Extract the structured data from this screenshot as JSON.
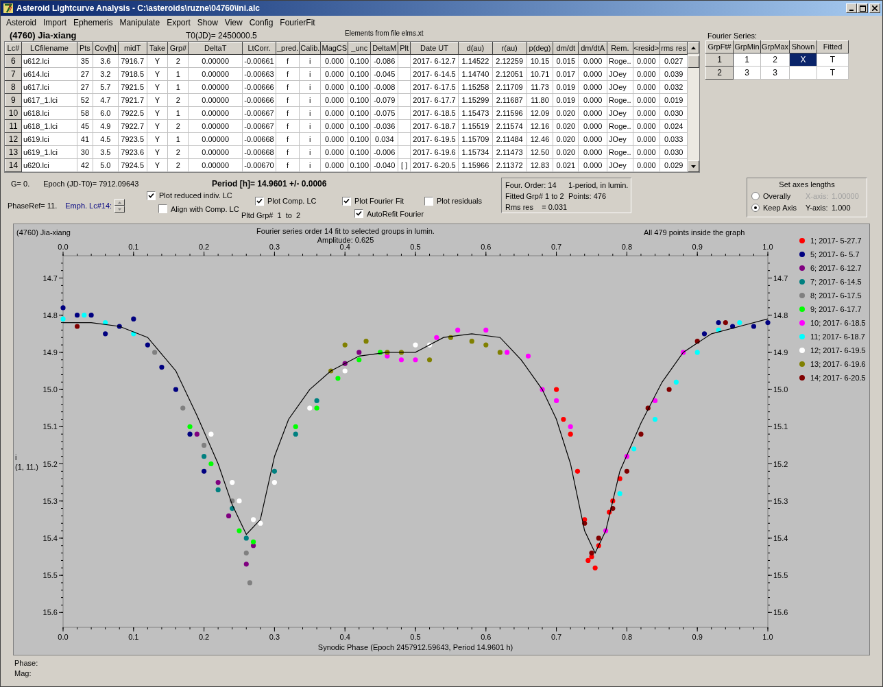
{
  "window": {
    "title": "Asteroid Lightcurve Analysis - C:\\asteroids\\ruzne\\04760\\ini.alc"
  },
  "menu": [
    "Asteroid",
    "Import",
    "Ephemeris",
    "Manipulate",
    "Export",
    "Show",
    "View",
    "Config",
    "FourierFit"
  ],
  "header": {
    "asteroid": "(4760) Jia-xiang",
    "t0": "T0(JD)= 2450000.5",
    "elements": "Elements from file elms.xt"
  },
  "table": {
    "columns": [
      "Lc#",
      "LCfilename",
      "Pts",
      "Cov[h]",
      "midT",
      "Take",
      "Grp#",
      "DeltaT",
      "LtCorr.",
      "_pred.",
      "Calib.",
      "MagCS",
      "_unc",
      "DeltaM",
      "Plt",
      "Date UT",
      "d(au)",
      "r(au)",
      "p(deg)",
      "dm/dt",
      "dm/dtA",
      "Rem.",
      "<resid>",
      "rms res"
    ],
    "rows": [
      {
        "cells": [
          "6",
          "u612.lci",
          "35",
          "3.6",
          "7916.7",
          "Y",
          "2",
          "0.00000",
          "-0.00661",
          "f",
          "i",
          "0.000",
          "0.100",
          "-0.086",
          null,
          "2017- 6-12.7",
          "1.14522",
          "2.12259",
          "10.15",
          "0.015",
          "0.000",
          "Roge..",
          "0.000",
          "0.027"
        ]
      },
      {
        "cells": [
          "7",
          "u614.lci",
          "27",
          "3.2",
          "7918.5",
          "Y",
          "1",
          "0.00000",
          "-0.00663",
          "f",
          "i",
          "0.000",
          "0.100",
          "-0.045",
          null,
          "2017- 6-14.5",
          "1.14740",
          "2.12051",
          "10.71",
          "0.017",
          "0.000",
          "JOey",
          "0.000",
          "0.039"
        ]
      },
      {
        "cells": [
          "8",
          "u617.lci",
          "27",
          "5.7",
          "7921.5",
          "Y",
          "1",
          "0.00000",
          "-0.00666",
          "f",
          "i",
          "0.000",
          "0.100",
          "-0.008",
          null,
          "2017- 6-17.5",
          "1.15258",
          "2.11709",
          "11.73",
          "0.019",
          "0.000",
          "JOey",
          "0.000",
          "0.032"
        ]
      },
      {
        "cells": [
          "9",
          "u617_1.lci",
          "52",
          "4.7",
          "7921.7",
          "Y",
          "2",
          "0.00000",
          "-0.00666",
          "f",
          "i",
          "0.000",
          "0.100",
          "-0.079",
          null,
          "2017- 6-17.7",
          "1.15299",
          "2.11687",
          "11.80",
          "0.019",
          "0.000",
          "Roge..",
          "0.000",
          "0.019"
        ]
      },
      {
        "cells": [
          "10",
          "u618.lci",
          "58",
          "6.0",
          "7922.5",
          "Y",
          "1",
          "0.00000",
          "-0.00667",
          "f",
          "i",
          "0.000",
          "0.100",
          "-0.075",
          null,
          "2017- 6-18.5",
          "1.15473",
          "2.11596",
          "12.09",
          "0.020",
          "0.000",
          "JOey",
          "0.000",
          "0.030"
        ]
      },
      {
        "cells": [
          "11",
          "u618_1.lci",
          "45",
          "4.9",
          "7922.7",
          "Y",
          "2",
          "0.00000",
          "-0.00667",
          "f",
          "i",
          "0.000",
          "0.100",
          "-0.036",
          null,
          "2017- 6-18.7",
          "1.15519",
          "2.11574",
          "12.16",
          "0.020",
          "0.000",
          "Roge..",
          "0.000",
          "0.024"
        ]
      },
      {
        "cells": [
          "12",
          "u619.lci",
          "41",
          "4.5",
          "7923.5",
          "Y",
          "1",
          "0.00000",
          "-0.00668",
          "f",
          "i",
          "0.000",
          "0.100",
          "0.034",
          null,
          "2017- 6-19.5",
          "1.15709",
          "2.11484",
          "12.46",
          "0.020",
          "0.000",
          "JOey",
          "0.000",
          "0.033"
        ]
      },
      {
        "cells": [
          "13",
          "u619_1.lci",
          "30",
          "3.5",
          "7923.6",
          "Y",
          "2",
          "0.00000",
          "-0.00668",
          "f",
          "i",
          "0.000",
          "0.100",
          "-0.006",
          null,
          "2017- 6-19.6",
          "1.15734",
          "2.11473",
          "12.50",
          "0.020",
          "0.000",
          "Roge..",
          "0.000",
          "0.030"
        ]
      },
      {
        "cells": [
          "14",
          "u620.lci",
          "42",
          "5.0",
          "7924.5",
          "Y",
          "2",
          "0.00000",
          "-0.00670",
          "f",
          "i",
          "0.000",
          "0.100",
          "-0.040",
          "[ ]",
          "2017- 6-20.5",
          "1.15966",
          "2.11372",
          "12.83",
          "0.021",
          "0.000",
          "JOey",
          "0.000",
          "0.029"
        ]
      }
    ]
  },
  "fourier": {
    "title": "Fourier Series:",
    "columns": [
      "GrpFt#",
      "GrpMin",
      "GrpMax",
      "Shown",
      "Fitted"
    ],
    "rows": [
      {
        "cells": [
          "1",
          "1",
          "2",
          "X",
          "T"
        ],
        "selected": true
      },
      {
        "cells": [
          "2",
          "3",
          "3",
          null,
          "T"
        ],
        "selected": false
      }
    ]
  },
  "controls": {
    "g": "G= 0.",
    "epoch": "Epoch (JD-T0)= 7912.09643",
    "period": "Period [h]= 14.9601 +/- 0.0006",
    "phase_ref": "PhaseRef= 11.",
    "emph": "Emph. Lc#14:",
    "pltd_grp": "Pltd Grp#  1  to  2",
    "checkboxes": [
      {
        "label": "Plot reduced indiv. LC",
        "checked": true
      },
      {
        "label": "Align with Comp. LC",
        "checked": false
      },
      {
        "label": "Plot Comp. LC",
        "checked": true
      },
      {
        "label": "Plot Fourier Fit",
        "checked": true
      },
      {
        "label": "Plot residuals",
        "checked": false
      },
      {
        "label": "AutoRefit Fourier",
        "checked": true
      }
    ]
  },
  "fit_info": [
    "Four. Order: 14",
    "1-period, in lumin.",
    "Fitted Grp# 1 to 2",
    "Points: 476",
    "Rms res    = 0.031"
  ],
  "axes": {
    "title": "Set axes lengths",
    "radios": [
      {
        "label": "Overally",
        "selected": false
      },
      {
        "label": "Keep Axis",
        "selected": true
      }
    ],
    "fields": [
      {
        "label": "X-axis:",
        "value": "1.00000",
        "disabled": true
      },
      {
        "label": "Y-axis:",
        "value": "1.000",
        "disabled": false
      }
    ]
  },
  "plot": {
    "object": "(4760) Jia-xiang",
    "subtitle": "Fourier series order 14 fit to selected groups in lumin.",
    "amplitude": "Amplitude: 0.625",
    "points_note": "All 479 points inside the graph",
    "y_units": "(1, 11.)",
    "right_axis_labels": [
      "14.7",
      "14.8",
      "14.9",
      "15.0",
      "15.1",
      "15.2",
      "15.3",
      "15.4",
      "15.5",
      "15.6"
    ],
    "chart_data": {
      "type": "scatter",
      "xlabel": "Synodic Phase (Epoch 2457912.59643, Period 14.9601 h)",
      "ylabel": "i",
      "xlim": [
        0,
        1
      ],
      "ylim": [
        15.64,
        14.64
      ],
      "xticks": [
        {
          "value": 0,
          "label": "0.0"
        },
        {
          "value": 0.1,
          "label": "0.1"
        },
        {
          "value": 0.2,
          "label": "0.2"
        },
        {
          "value": 0.3,
          "label": "0.3"
        },
        {
          "value": 0.4,
          "label": "0.4"
        },
        {
          "value": 0.5,
          "label": "0.5"
        },
        {
          "value": 0.6,
          "label": "0.6"
        },
        {
          "value": 0.7,
          "label": "0.7"
        },
        {
          "value": 0.8,
          "label": "0.8"
        },
        {
          "value": 0.9,
          "label": "0.9"
        },
        {
          "value": 1,
          "label": "1.0"
        }
      ],
      "yticks": [
        14.7,
        14.8,
        14.9,
        {
          "value": 15,
          "label": "15.0"
        },
        15.1,
        15.2,
        15.3,
        15.4,
        15.5,
        15.6
      ],
      "series": [
        {
          "name": "1; 2017- 5-27.7",
          "color": "#ff0000",
          "x": [
            0.7,
            0.71,
            0.72,
            0.73,
            0.74,
            0.745,
            0.75,
            0.755,
            0.76,
            0.775,
            0.78,
            0.79
          ],
          "values": [
            15.0,
            15.08,
            15.12,
            15.22,
            15.35,
            15.46,
            15.45,
            15.48,
            15.42,
            15.33,
            15.3,
            15.24
          ]
        },
        {
          "name": "5; 2017- 6- 5.7",
          "color": "#000080",
          "x": [
            0,
            0.02,
            0.04,
            0.06,
            0.08,
            0.1,
            0.12,
            0.14,
            0.16,
            0.18,
            0.2,
            0.91,
            0.93,
            0.95,
            0.98,
            1
          ],
          "values": [
            14.78,
            14.8,
            14.8,
            14.85,
            14.83,
            14.81,
            14.88,
            14.94,
            15.0,
            15.12,
            15.22,
            14.85,
            14.82,
            14.83,
            14.83,
            14.82
          ]
        },
        {
          "name": "6; 2017- 6-12.7",
          "color": "#800080",
          "x": [
            0.19,
            0.22,
            0.235,
            0.26,
            0.27,
            0.4,
            0.42
          ],
          "values": [
            15.12,
            15.25,
            15.34,
            15.47,
            15.42,
            14.93,
            14.9
          ]
        },
        {
          "name": "7; 2017- 6-14.5",
          "color": "#008080",
          "x": [
            0.2,
            0.22,
            0.24,
            0.26,
            0.3,
            0.33,
            0.36
          ],
          "values": [
            15.18,
            15.27,
            15.32,
            15.4,
            15.22,
            15.12,
            15.03
          ]
        },
        {
          "name": "8; 2017- 6-17.5",
          "color": "#808080",
          "x": [
            0.13,
            0.17,
            0.2,
            0.24,
            0.26,
            0.265
          ],
          "values": [
            14.9,
            15.05,
            15.15,
            15.3,
            15.44,
            15.52
          ]
        },
        {
          "name": "9; 2017- 6-17.7",
          "color": "#00ff00",
          "x": [
            0.18,
            0.21,
            0.25,
            0.27,
            0.33,
            0.36,
            0.39,
            0.42,
            0.45
          ],
          "values": [
            15.1,
            15.2,
            15.38,
            15.41,
            15.1,
            15.05,
            14.97,
            14.92,
            14.9
          ]
        },
        {
          "name": "10; 2017- 6-18.5",
          "color": "#ff00ff",
          "x": [
            0.46,
            0.48,
            0.5,
            0.53,
            0.56,
            0.6,
            0.63,
            0.66,
            0.68,
            0.7,
            0.72,
            0.77,
            0.8,
            0.84,
            0.88
          ],
          "values": [
            14.91,
            14.92,
            14.92,
            14.86,
            14.84,
            14.84,
            14.9,
            14.91,
            15.0,
            15.03,
            15.1,
            15.38,
            15.18,
            15.03,
            14.9
          ]
        },
        {
          "name": "11; 2017- 6-18.7",
          "color": "#00ffff",
          "x": [
            0,
            0.03,
            0.06,
            0.1,
            0.79,
            0.81,
            0.84,
            0.87,
            0.9,
            0.93,
            0.96
          ],
          "values": [
            14.81,
            14.8,
            14.82,
            14.85,
            15.28,
            15.16,
            15.08,
            14.98,
            14.9,
            14.84,
            14.82
          ]
        },
        {
          "name": "12; 2017- 6-19.5",
          "color": "#ffffff",
          "x": [
            0.21,
            0.24,
            0.25,
            0.27,
            0.28,
            0.3,
            0.35,
            0.4,
            0.5,
            0.52
          ],
          "values": [
            15.12,
            15.25,
            15.3,
            15.35,
            15.36,
            15.25,
            15.05,
            14.95,
            14.88,
            14.88
          ]
        },
        {
          "name": "13; 2017- 6-19.6",
          "color": "#808000",
          "x": [
            0.38,
            0.4,
            0.43,
            0.46,
            0.48,
            0.52,
            0.55,
            0.58,
            0.6,
            0.62
          ],
          "values": [
            14.95,
            14.88,
            14.87,
            14.9,
            14.9,
            14.92,
            14.86,
            14.87,
            14.88,
            14.9
          ]
        },
        {
          "name": "14; 2017- 6-20.5",
          "color": "#800000",
          "x": [
            0.02,
            0.74,
            0.75,
            0.76,
            0.78,
            0.8,
            0.82,
            0.83,
            0.86,
            0.9,
            0.94
          ],
          "values": [
            14.83,
            15.36,
            15.44,
            15.4,
            15.32,
            15.22,
            15.12,
            15.05,
            15.0,
            14.87,
            14.82
          ]
        },
        {
          "type": "line",
          "color": "#000000",
          "x": [
            0,
            0.04,
            0.08,
            0.12,
            0.16,
            0.19,
            0.22,
            0.24,
            0.26,
            0.28,
            0.3,
            0.32,
            0.35,
            0.38,
            0.42,
            0.46,
            0.5,
            0.54,
            0.58,
            0.62,
            0.65,
            0.68,
            0.7,
            0.72,
            0.74,
            0.755,
            0.77,
            0.79,
            0.82,
            0.85,
            0.88,
            0.92,
            0.96,
            1
          ],
          "values": [
            14.82,
            14.82,
            14.83,
            14.86,
            14.95,
            15.07,
            15.2,
            15.31,
            15.39,
            15.35,
            15.18,
            15.08,
            15.0,
            14.95,
            14.91,
            14.9,
            14.9,
            14.86,
            14.85,
            14.86,
            14.92,
            15.0,
            15.08,
            15.2,
            15.38,
            15.44,
            15.38,
            15.22,
            15.09,
            14.98,
            14.9,
            14.85,
            14.83,
            14.81
          ]
        }
      ]
    }
  },
  "status": [
    "Phase:",
    "Mag:"
  ]
}
